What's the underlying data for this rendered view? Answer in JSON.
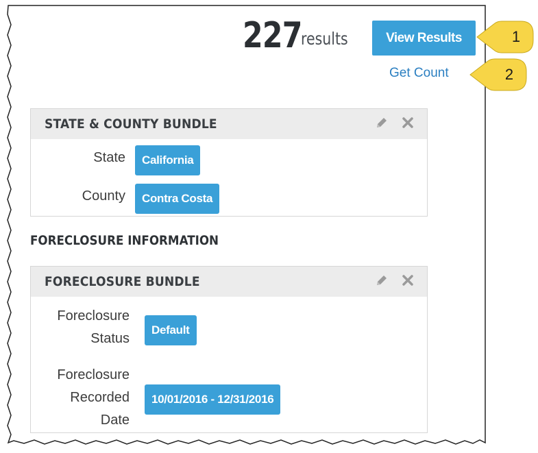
{
  "results": {
    "count": "227",
    "label": "results"
  },
  "actions": {
    "view_results": "View Results",
    "get_count": "Get Count"
  },
  "callouts": [
    "1",
    "2"
  ],
  "state_county_bundle": {
    "title": "STATE & COUNTY BUNDLE",
    "fields": [
      {
        "label": "State",
        "value": "California"
      },
      {
        "label": "County",
        "value": "Contra Costa"
      }
    ]
  },
  "foreclosure_section": {
    "heading": "FORECLOSURE INFORMATION"
  },
  "foreclosure_bundle": {
    "title": "FORECLOSURE BUNDLE",
    "fields": [
      {
        "label_lines": [
          "Foreclosure",
          "Status"
        ],
        "value": "Default"
      },
      {
        "label_lines": [
          "Foreclosure",
          "Recorded",
          "Date"
        ],
        "value": "10/01/2016 - 12/31/2016"
      }
    ]
  },
  "icons": {
    "edit": "pencil-icon",
    "remove": "close-icon"
  },
  "colors": {
    "accent": "#3aa0d8",
    "link": "#2b7fc1",
    "callout": "#f7d547",
    "header_bg": "#ececec"
  }
}
